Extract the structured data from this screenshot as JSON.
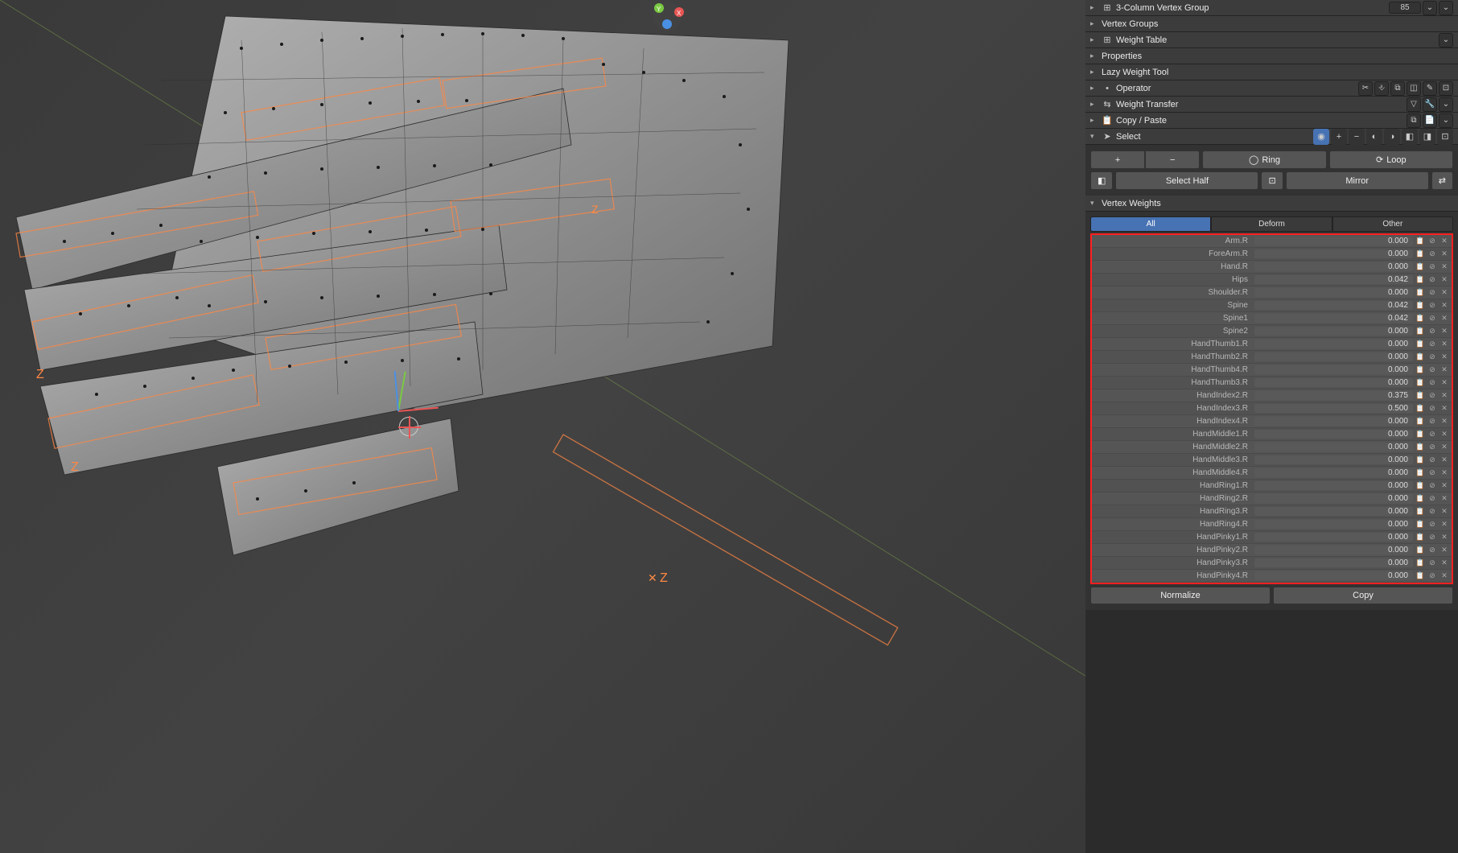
{
  "panels": {
    "vertex_group_3col": {
      "title": "3-Column Vertex Group",
      "value": "85"
    },
    "vertex_groups": {
      "title": "Vertex Groups"
    },
    "weight_table": {
      "title": "Weight Table"
    },
    "properties": {
      "title": "Properties"
    },
    "lazy_weight_tool": {
      "title": "Lazy Weight Tool"
    },
    "operator": {
      "title": "Operator"
    },
    "weight_transfer": {
      "title": "Weight Transfer"
    },
    "copy_paste": {
      "title": "Copy / Paste"
    },
    "select": {
      "title": "Select"
    },
    "vertex_weights": {
      "title": "Vertex Weights"
    }
  },
  "select_panel": {
    "plus": "+",
    "minus": "−",
    "ring": "Ring",
    "loop": "Loop",
    "select_half": "Select Half",
    "mirror": "Mirror"
  },
  "tabs": {
    "all": "All",
    "deform": "Deform",
    "other": "Other"
  },
  "weights": [
    {
      "name": "Arm.R",
      "value": "0.000"
    },
    {
      "name": "ForeArm.R",
      "value": "0.000"
    },
    {
      "name": "Hand.R",
      "value": "0.000"
    },
    {
      "name": "Hips",
      "value": "0.042"
    },
    {
      "name": "Shoulder.R",
      "value": "0.000"
    },
    {
      "name": "Spine",
      "value": "0.042"
    },
    {
      "name": "Spine1",
      "value": "0.042"
    },
    {
      "name": "Spine2",
      "value": "0.000"
    },
    {
      "name": "HandThumb1.R",
      "value": "0.000"
    },
    {
      "name": "HandThumb2.R",
      "value": "0.000"
    },
    {
      "name": "HandThumb4.R",
      "value": "0.000"
    },
    {
      "name": "HandThumb3.R",
      "value": "0.000"
    },
    {
      "name": "HandIndex2.R",
      "value": "0.375"
    },
    {
      "name": "HandIndex3.R",
      "value": "0.500"
    },
    {
      "name": "HandIndex4.R",
      "value": "0.000"
    },
    {
      "name": "HandMiddle1.R",
      "value": "0.000"
    },
    {
      "name": "HandMiddle2.R",
      "value": "0.000"
    },
    {
      "name": "HandMiddle3.R",
      "value": "0.000"
    },
    {
      "name": "HandMiddle4.R",
      "value": "0.000"
    },
    {
      "name": "HandRing1.R",
      "value": "0.000"
    },
    {
      "name": "HandRing2.R",
      "value": "0.000"
    },
    {
      "name": "HandRing3.R",
      "value": "0.000"
    },
    {
      "name": "HandRing4.R",
      "value": "0.000"
    },
    {
      "name": "HandPinky1.R",
      "value": "0.000"
    },
    {
      "name": "HandPinky2.R",
      "value": "0.000"
    },
    {
      "name": "HandPinky3.R",
      "value": "0.000"
    },
    {
      "name": "HandPinky4.R",
      "value": "0.000"
    }
  ],
  "bottom_buttons": {
    "normalize": "Normalize",
    "copy": "Copy"
  }
}
